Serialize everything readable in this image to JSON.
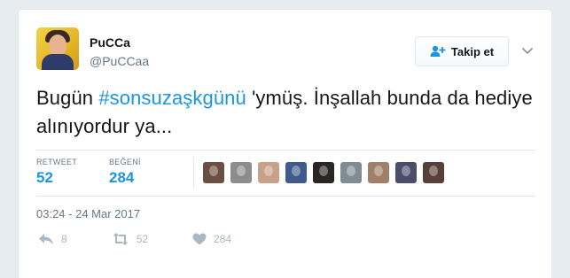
{
  "author": {
    "name": "PuCCa",
    "handle": "@PuCCaa",
    "avatar_icon": "user-avatar"
  },
  "follow_button": {
    "label": "Takip et",
    "icon": "add-user-icon"
  },
  "menu_icon": "chevron-down-icon",
  "tweet": {
    "text_before": "Bugün ",
    "hashtag": "#sonsuzaşkgünü",
    "text_after": " 'ymüş. İnşallah bunda da hediye alınıyordur ya..."
  },
  "stats": {
    "retweet_label": "RETWEET",
    "retweet_count": "52",
    "like_label": "BEĞENİ",
    "like_count": "284"
  },
  "likers": [
    {
      "icon": "liker-avatar",
      "color": "#6b4f43"
    },
    {
      "icon": "liker-avatar",
      "color": "#8c8c8c"
    },
    {
      "icon": "liker-avatar",
      "color": "#c9a089"
    },
    {
      "icon": "liker-avatar",
      "color": "#3f5b8c"
    },
    {
      "icon": "liker-avatar",
      "color": "#2a2626"
    },
    {
      "icon": "liker-avatar",
      "color": "#7f8c94"
    },
    {
      "icon": "liker-avatar",
      "color": "#a08068"
    },
    {
      "icon": "liker-avatar",
      "color": "#4a4e6b"
    },
    {
      "icon": "liker-avatar",
      "color": "#5a3f38"
    }
  ],
  "timestamp": "03:24 - 24 Mar 2017",
  "actions": {
    "reply_count": "8",
    "retweet_count": "52",
    "like_count": "284"
  },
  "colors": {
    "accent": "#1b95e0",
    "muted": "#657786",
    "icon_muted": "#aab8c2"
  }
}
